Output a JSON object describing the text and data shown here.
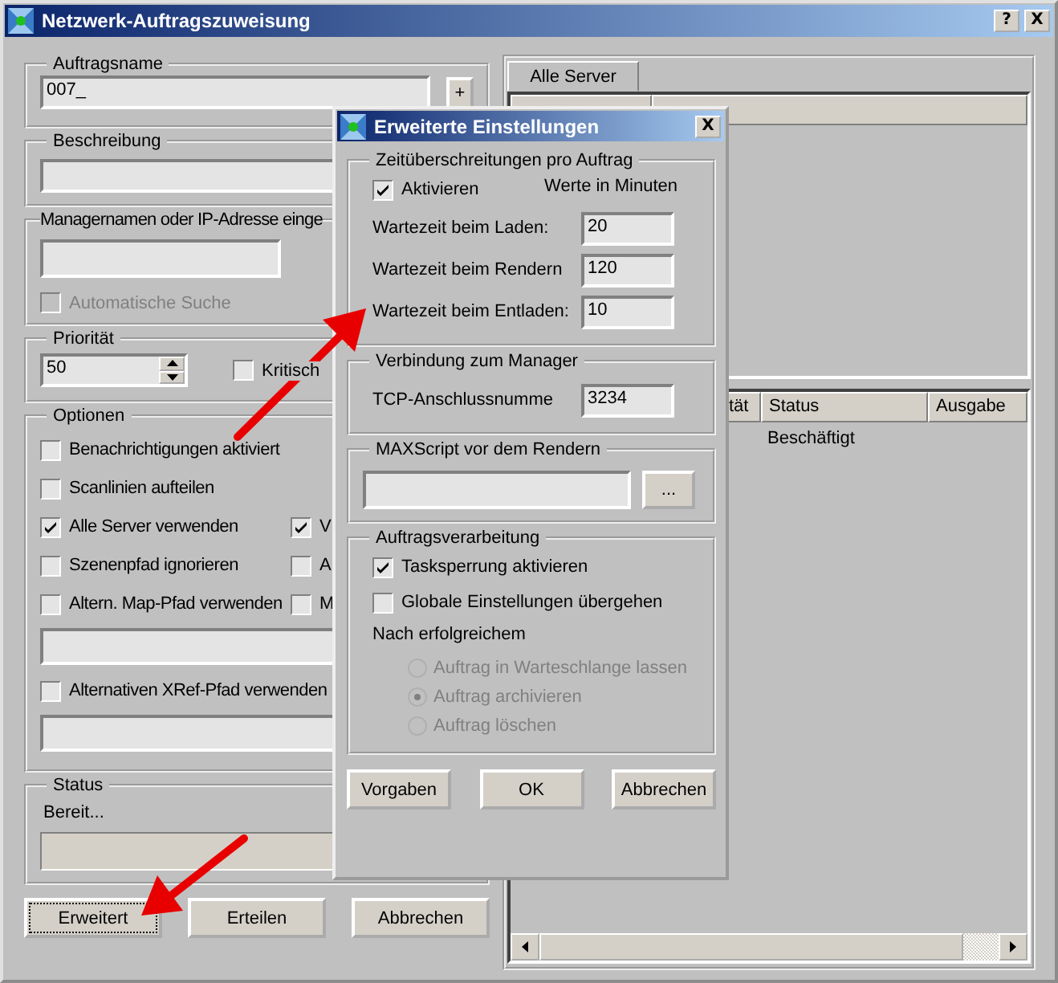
{
  "window": {
    "title": "Netzwerk-Auftragszuweisung",
    "help_button": "?",
    "close_button": "X"
  },
  "job_name": {
    "label": "Auftragsname",
    "value": "007_",
    "add_button": "+"
  },
  "description": {
    "label": "Beschreibung"
  },
  "manager": {
    "label": "Managernamen oder IP-Adresse einge",
    "auto_search": {
      "label": "Automatische Suche",
      "checked": false,
      "disabled": true
    }
  },
  "priority": {
    "label": "Priorität",
    "value": "50",
    "critical": {
      "label": "Kritisch",
      "checked": false
    }
  },
  "options": {
    "label": "Optionen",
    "rows": [
      {
        "kind": "check",
        "items": [
          {
            "label": "Benachrichtigungen aktiviert",
            "checked": false
          }
        ]
      },
      {
        "kind": "check",
        "items": [
          {
            "label": "Scanlinien aufteilen",
            "checked": false
          }
        ]
      },
      {
        "kind": "check",
        "items": [
          {
            "label": "Alle Server verwenden",
            "checked": true
          },
          {
            "label": "V",
            "checked": true
          }
        ]
      },
      {
        "kind": "check",
        "items": [
          {
            "label": "Szenenpfad ignorieren",
            "checked": false
          },
          {
            "label": "A",
            "checked": false
          }
        ]
      },
      {
        "kind": "check",
        "items": [
          {
            "label": "Altern. Map-Pfad verwenden",
            "checked": false
          },
          {
            "label": "M",
            "checked": false
          }
        ]
      },
      {
        "kind": "field"
      },
      {
        "kind": "check",
        "items": [
          {
            "label": "Alternativen XRef-Pfad verwenden",
            "checked": false
          }
        ]
      },
      {
        "kind": "field"
      }
    ]
  },
  "status": {
    "label": "Status",
    "text": "Bereit..."
  },
  "buttons": [
    {
      "label": "Erweitert",
      "focused": true
    },
    {
      "label": "Erteilen",
      "focused": false
    },
    {
      "label": "Abbrechen",
      "focused": false
    }
  ],
  "tabs": [
    {
      "label": "Alle Server",
      "selected": true
    }
  ],
  "server_table": {
    "columns": [
      "tät",
      "Status",
      "Ausgabe"
    ],
    "rows": [
      {
        "status": "Beschäftigt"
      }
    ]
  },
  "advanced_dialog": {
    "title": "Erweiterte Einstellungen",
    "close_button": "X",
    "timeouts": {
      "label": "Zeitüberschreitungen pro Auftrag",
      "enable": {
        "label": "Aktivieren",
        "checked": true
      },
      "units": "Werte in Minuten",
      "fields": [
        {
          "label": "Wartezeit beim Laden:",
          "value": "20"
        },
        {
          "label": "Wartezeit beim Rendern",
          "value": "120"
        },
        {
          "label": "Wartezeit beim Entladen:",
          "value": "10"
        }
      ]
    },
    "connection": {
      "label": "Verbindung zum Manager",
      "field_label": "TCP-Anschlussnumme",
      "value": "3234"
    },
    "maxscript": {
      "label": "MAXScript vor dem Rendern",
      "browse_button": "..."
    },
    "processing": {
      "label": "Auftragsverarbeitung",
      "checkboxes": [
        {
          "label": "Tasksperrung aktivieren",
          "checked": true
        },
        {
          "label": "Globale Einstellungen übergehen",
          "checked": false
        }
      ],
      "after_label": "Nach erfolgreichem",
      "radios_disabled": true,
      "radios": [
        {
          "label": "Auftrag in Warteschlange lassen",
          "selected": false
        },
        {
          "label": "Auftrag archivieren",
          "selected": true
        },
        {
          "label": "Auftrag löschen",
          "selected": false
        }
      ]
    },
    "buttons": [
      "Vorgaben",
      "OK",
      "Abbrechen"
    ]
  }
}
